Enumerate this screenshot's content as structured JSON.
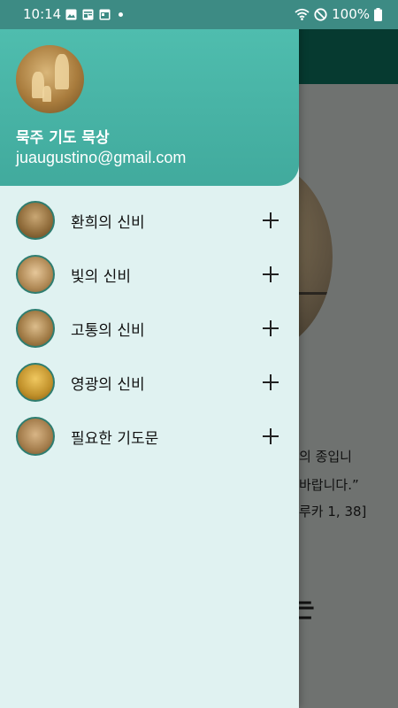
{
  "status_bar": {
    "time": "10:14",
    "left_icons": [
      "image-icon",
      "news-icon",
      "window-icon",
      "dot-icon"
    ],
    "right_icons": [
      "wifi-icon",
      "do-not-disturb-icon"
    ],
    "battery": "100%"
  },
  "drawer": {
    "title": "묵주 기도 묵상",
    "email": "juaugustino@gmail.com",
    "items": [
      {
        "label": "환희의 신비",
        "icon": "expand-plus-icon"
      },
      {
        "label": "빛의 신비",
        "icon": "expand-plus-icon"
      },
      {
        "label": "고통의 신비",
        "icon": "expand-plus-icon"
      },
      {
        "label": "영광의 신비",
        "icon": "expand-plus-icon"
      },
      {
        "label": "필요한 기도문",
        "icon": "expand-plus-icon"
      }
    ]
  },
  "background": {
    "quote_line1": "의 종입니",
    "quote_line2": "바랍니다.”",
    "quote_ref": "루카 1, 38]",
    "heading_fragment": "는"
  },
  "colors": {
    "header": "#4db6ac",
    "drawer_bg": "#e0f2f1",
    "app_bar": "#063a30",
    "status_bar": "#3d8b84"
  }
}
